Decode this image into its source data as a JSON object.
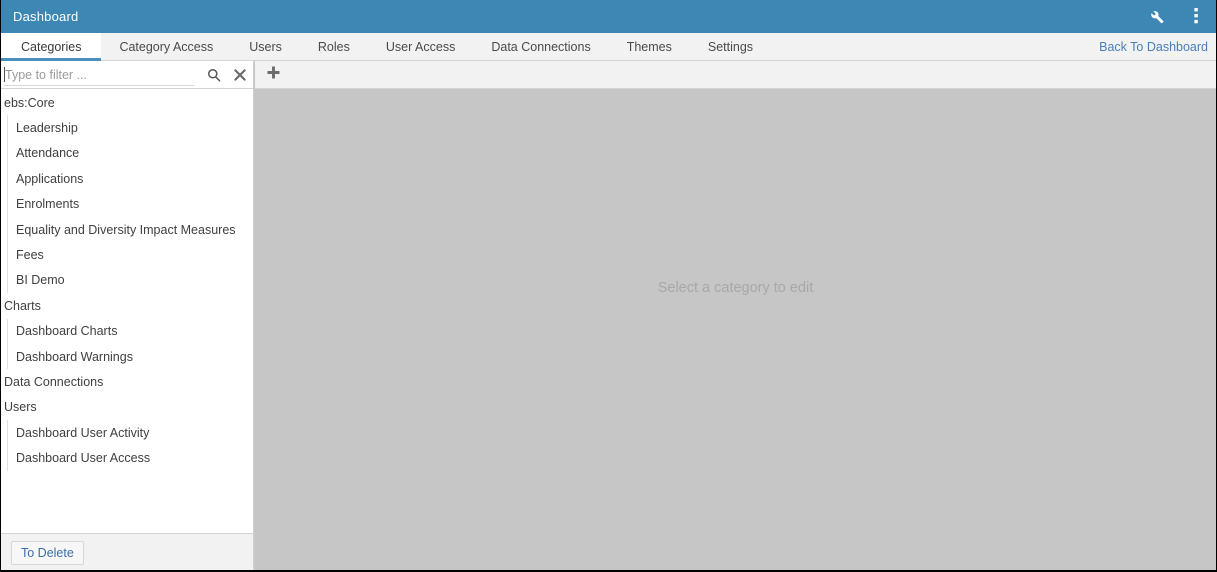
{
  "titlebar": {
    "title": "Dashboard",
    "icons": [
      {
        "name": "wrench-icon",
        "label": "Settings"
      },
      {
        "name": "more-vertical-icon",
        "label": "More options"
      }
    ]
  },
  "tabs": [
    {
      "label": "Categories",
      "active": true
    },
    {
      "label": "Category Access",
      "active": false
    },
    {
      "label": "Users",
      "active": false
    },
    {
      "label": "Roles",
      "active": false
    },
    {
      "label": "User Access",
      "active": false
    },
    {
      "label": "Data Connections",
      "active": false
    },
    {
      "label": "Themes",
      "active": false
    },
    {
      "label": "Settings",
      "active": false
    }
  ],
  "back_link": {
    "label": "Back To Dashboard"
  },
  "filter": {
    "value": "",
    "placeholder": "Type to filter ...",
    "search_icon": "search-icon",
    "clear_icon": "clear-icon"
  },
  "tree": {
    "items": [
      {
        "label": "ebs:Core",
        "level": 0
      },
      {
        "label": "Leadership",
        "level": 1
      },
      {
        "label": "Attendance",
        "level": 1
      },
      {
        "label": "Applications",
        "level": 1
      },
      {
        "label": "Enrolments",
        "level": 1
      },
      {
        "label": "Equality and Diversity Impact Measures",
        "level": 1
      },
      {
        "label": "Fees",
        "level": 1
      },
      {
        "label": "BI Demo",
        "level": 1
      },
      {
        "label": "Charts",
        "level": 0
      },
      {
        "label": "Dashboard Charts",
        "level": 1
      },
      {
        "label": "Dashboard Warnings",
        "level": 1
      },
      {
        "label": "Data Connections",
        "level": 0
      },
      {
        "label": "Users",
        "level": 0
      },
      {
        "label": "Dashboard User Activity",
        "level": 1
      },
      {
        "label": "Dashboard User Access",
        "level": 1
      }
    ]
  },
  "footer": {
    "to_delete_label": "To Delete"
  },
  "toolbar": {
    "add_icon": "plus-icon"
  },
  "content": {
    "placeholder": "Select a category to edit"
  },
  "colors": {
    "titlebar_blue": "#3c87b3",
    "tab_accent": "#4a90bf",
    "link_blue": "#4a7fb5",
    "content_gray": "#c6c6c6",
    "panel_white": "#ffffff",
    "strip_gray": "#f2f2f2"
  }
}
